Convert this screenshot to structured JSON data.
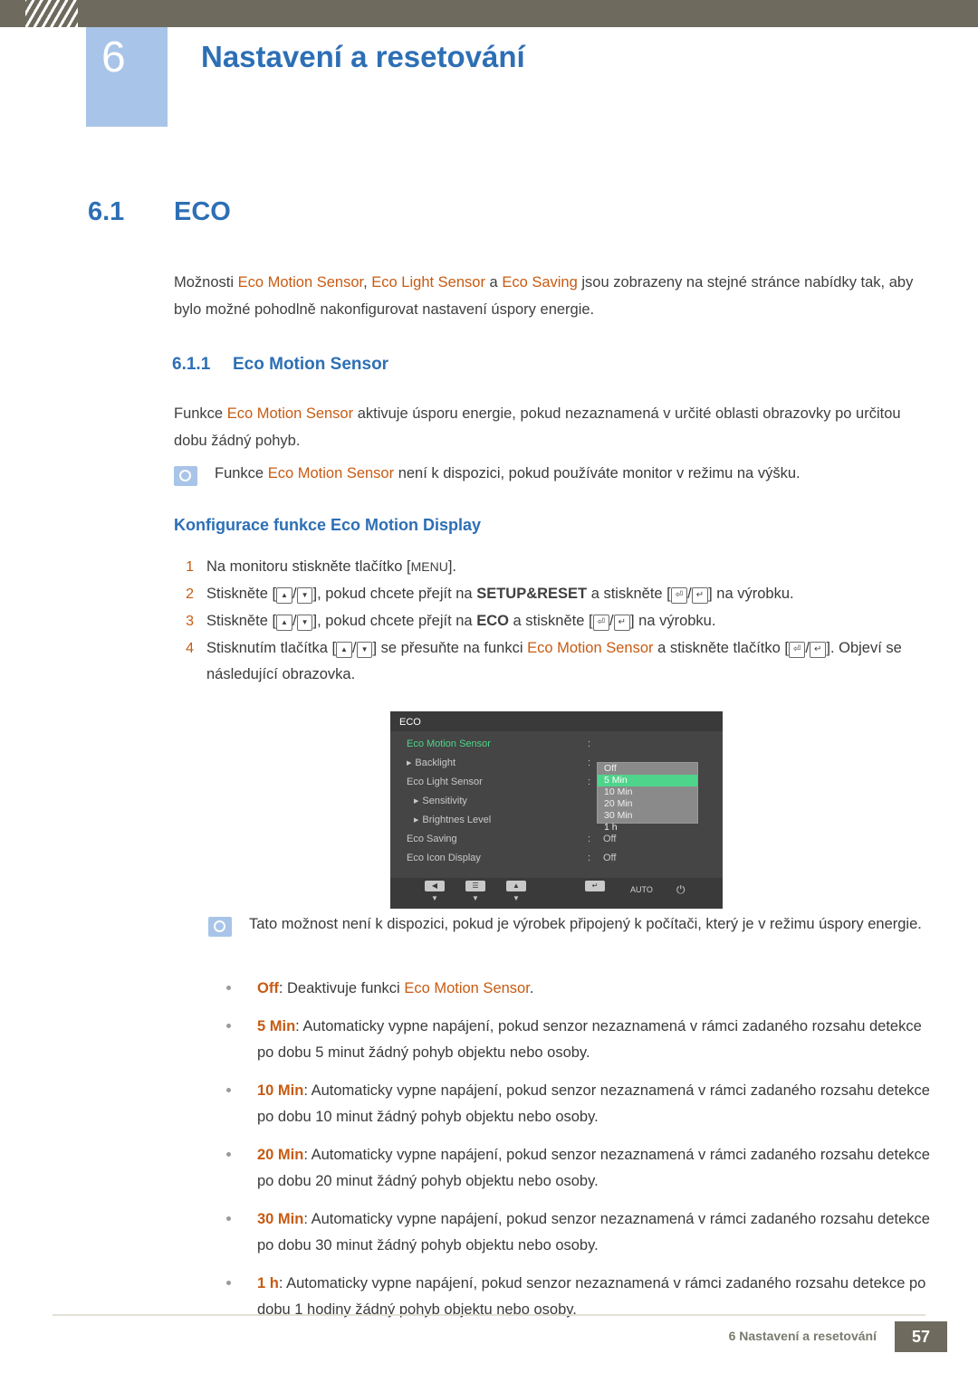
{
  "header": {
    "chapter_number": "6",
    "chapter_title": "Nastavení a resetování"
  },
  "section": {
    "number": "6.1",
    "title": "ECO",
    "intro_1": "Možnosti ",
    "intro_hl_1": "Eco Motion Sensor",
    "intro_2": ", ",
    "intro_hl_2": "Eco Light Sensor",
    "intro_3": " a ",
    "intro_hl_3": "Eco Saving",
    "intro_4": " jsou zobrazeny na stejné stránce nabídky tak, aby bylo možné pohodlně nakonfigurovat nastavení úspory energie."
  },
  "subsection": {
    "number": "6.1.1",
    "title": "Eco Motion Sensor",
    "para_1": "Funkce ",
    "para_hl": "Eco Motion Sensor",
    "para_2": " aktivuje úsporu energie, pokud nezaznamená v určité oblasti obrazovky po určitou dobu žádný pohyb.",
    "note_1a": "Funkce ",
    "note_1_hl": "Eco Motion Sensor",
    "note_1b": " není k dispozici, pokud používáte monitor v režimu na výšku.",
    "config_heading": "Konfigurace funkce Eco Motion Display"
  },
  "steps": [
    {
      "num": "1",
      "t1": "Na monitoru stiskněte tlačítko [",
      "key1": "MENU",
      "t2": "]."
    },
    {
      "num": "2",
      "t1": "Stiskněte [",
      "t2": "], pokud chcete přejít na ",
      "hl": "SETUP&RESET",
      "t3": " a stiskněte [",
      "t4": "] na výrobku."
    },
    {
      "num": "3",
      "t1": "Stiskněte [",
      "t2": "], pokud chcete přejít na ",
      "hl": "ECO",
      "t3": " a stiskněte [",
      "t4": "] na výrobku."
    },
    {
      "num": "4",
      "t1": "Stisknutím tlačítka [",
      "t2": "] se přesuňte na funkci ",
      "hl": "Eco Motion Sensor",
      "t3": " a stiskněte tlačítko [",
      "t4": "]. Objeví se následující obrazovka."
    }
  ],
  "osd": {
    "title": "ECO",
    "rows": [
      {
        "label": "Eco Motion Sensor",
        "arrow": false,
        "active": true,
        "colon": ":",
        "value": ""
      },
      {
        "label": "Backlight",
        "arrow": true,
        "active": false,
        "colon": ":",
        "value": ""
      },
      {
        "label": "Eco Light Sensor",
        "arrow": false,
        "active": false,
        "colon": ":",
        "value": ""
      },
      {
        "label": "Sensitivity",
        "arrow": true,
        "active": false,
        "colon": "",
        "value": ""
      },
      {
        "label": "Brightnes Level",
        "arrow": true,
        "active": false,
        "colon": "",
        "value": ""
      },
      {
        "label": "Eco Saving",
        "arrow": false,
        "active": false,
        "colon": ":",
        "value": "Off"
      },
      {
        "label": "Eco Icon Display",
        "arrow": false,
        "active": false,
        "colon": ":",
        "value": "Off"
      }
    ],
    "options": [
      "Off",
      "5 Min",
      "10 Min",
      "20 Min",
      "30 Min",
      "1 h"
    ],
    "selected_option": "5 Min",
    "buttons": [
      {
        "glyph": "◀",
        "sub": "▼",
        "label": ""
      },
      {
        "glyph": "☰",
        "sub": "▼",
        "label": ""
      },
      {
        "glyph": "▲",
        "sub": "▼",
        "label": ""
      },
      {
        "glyph": "↵",
        "sub": "",
        "label": ""
      },
      {
        "glyph": "",
        "sub": "",
        "label": "AUTO"
      },
      {
        "glyph": "⏻",
        "sub": "",
        "label": ""
      }
    ]
  },
  "note_2": "Tato možnost není k dispozici, pokud je výrobek připojený k počítači, který je v režimu úspory energie.",
  "bullets": [
    {
      "term": "Off",
      "t1": ": Deaktivuje funkci ",
      "hl": "Eco Motion Sensor",
      "t2": "."
    },
    {
      "term": "5 Min",
      "t1": ": Automaticky vypne napájení, pokud senzor nezaznamená v rámci zadaného rozsahu detekce po dobu 5 minut žádný pohyb objektu nebo osoby."
    },
    {
      "term": "10 Min",
      "t1": ": Automaticky vypne napájení, pokud senzor nezaznamená v rámci zadaného rozsahu detekce po dobu 10 minut žádný pohyb objektu nebo osoby."
    },
    {
      "term": "20 Min",
      "t1": ": Automaticky vypne napájení, pokud senzor nezaznamená v rámci zadaného rozsahu detekce po dobu 20 minut žádný pohyb objektu nebo osoby."
    },
    {
      "term": "30 Min",
      "t1": ": Automaticky vypne napájení, pokud senzor nezaznamená v rámci zadaného rozsahu detekce po dobu 30 minut žádný pohyb objektu nebo osoby."
    },
    {
      "term": "1 h",
      "t1": ": Automaticky vypne napájení, pokud senzor nezaznamená v rámci zadaného rozsahu detekce po dobu 1 hodiny žádný pohyb objektu nebo osoby."
    }
  ],
  "footer": {
    "text": "6 Nastavení a resetování",
    "page": "57"
  },
  "colors": {
    "header_bar": "#6e6b5e",
    "accent_blue": "#2d6fb5",
    "light_blue": "#a8c4e8",
    "orange": "#c75b12",
    "osd_green": "#4fd48b"
  }
}
